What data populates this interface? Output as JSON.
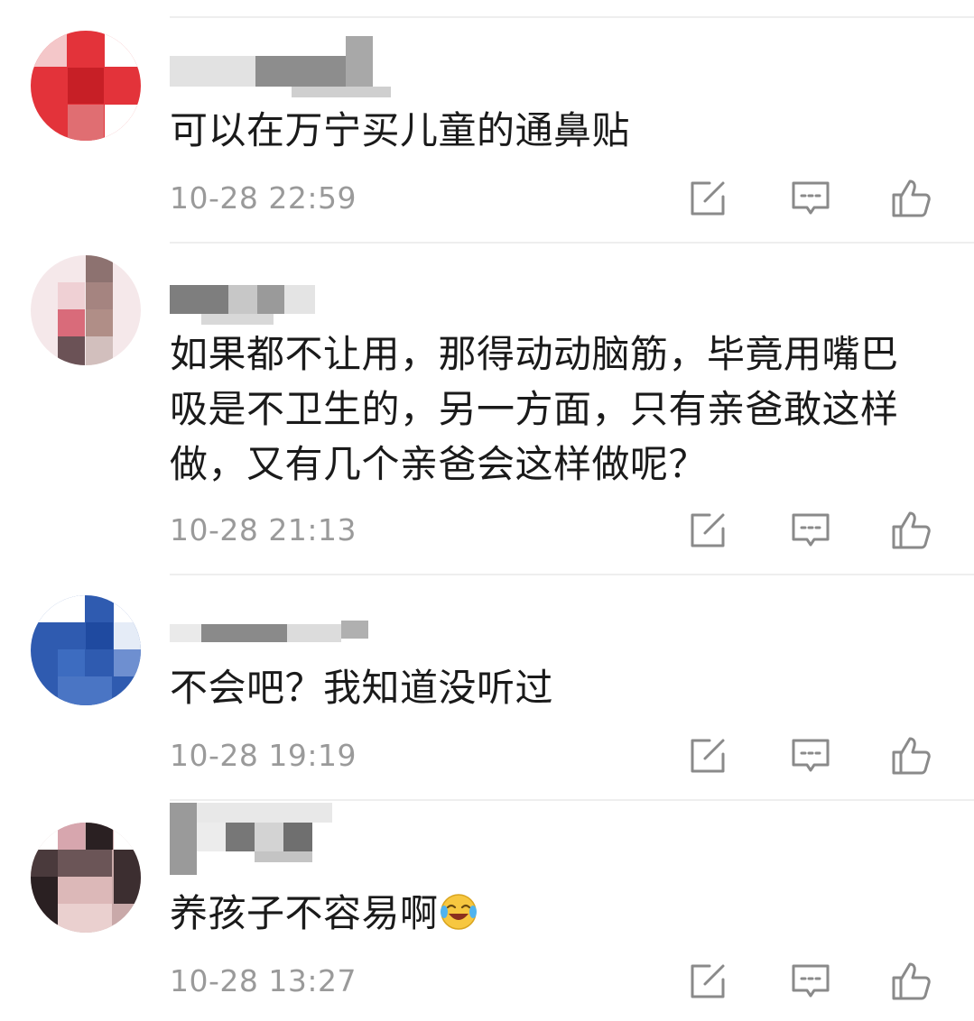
{
  "comments": [
    {
      "text": "可以在万宁买儿童的通鼻贴",
      "time": "10-28 22:59"
    },
    {
      "text": "如果都不让用，那得动动脑筋，毕竟用嘴巴\n吸是不卫生的，另一方面，只有亲爸敢这样\n做，又有几个亲爸会这样做呢？",
      "time": "10-28 21:13"
    },
    {
      "text": "不会吧？我知道没听过",
      "time": "10-28 19:19"
    },
    {
      "text": "养孩子不容易啊",
      "time": "10-28 13:27",
      "emoji": "crying-laughing-emoji"
    }
  ],
  "icons": {
    "edit": "edit-icon",
    "reply": "comment-icon",
    "like": "thumbs-up-icon"
  },
  "colors": {
    "text": "#1a1a1a",
    "time": "#9a9a9a",
    "icon": "#8a8a8a",
    "divider": "#eeeeee"
  }
}
